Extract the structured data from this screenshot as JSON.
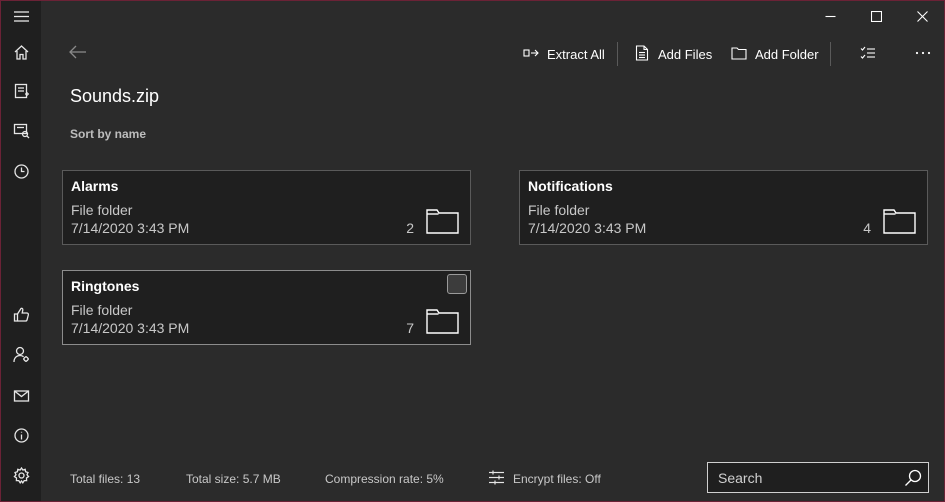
{
  "app": {
    "title": "Sounds.zip",
    "sort_label": "Sort by name"
  },
  "toolbar": {
    "extract_all": "Extract All",
    "add_files": "Add Files",
    "add_folder": "Add Folder"
  },
  "items": [
    {
      "name": "Alarms",
      "type": "File folder",
      "date": "7/14/2020 3:43 PM",
      "count": "2"
    },
    {
      "name": "Notifications",
      "type": "File folder",
      "date": "7/14/2020 3:43 PM",
      "count": "4"
    },
    {
      "name": "Ringtones",
      "type": "File folder",
      "date": "7/14/2020 3:43 PM",
      "count": "7"
    }
  ],
  "status": {
    "total_files": "Total files: 13",
    "total_size": "Total size: 5.7 MB",
    "compression_rate": "Compression rate: 5%",
    "encrypt_files": "Encrypt files: Off"
  },
  "search": {
    "placeholder": "Search",
    "value": ""
  },
  "icons": {
    "rail": [
      "hamburger-menu-icon",
      "home-icon",
      "new-archive-icon",
      "open-archive-icon",
      "history-icon",
      "thumbs-up-icon",
      "account-icon",
      "mail-icon",
      "info-icon",
      "settings-icon"
    ],
    "caption": [
      "minimize-icon",
      "maximize-icon",
      "close-icon"
    ]
  },
  "colors": {
    "background": "#2b2b2b",
    "rail": "#1f1f1f",
    "card": "#1f1f1f",
    "window_border": "#6b2236"
  }
}
